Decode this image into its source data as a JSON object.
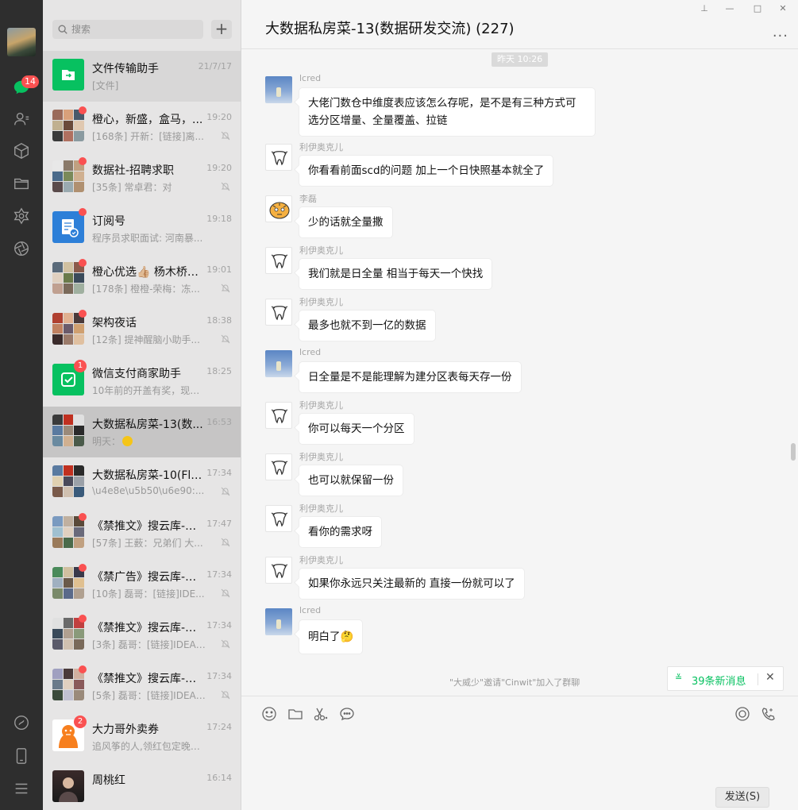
{
  "nav": {
    "unread_badge": "14"
  },
  "search": {
    "placeholder": "搜索",
    "add_label": "+"
  },
  "chats": [
    {
      "name": "文件传输助手",
      "time": "21/7/17",
      "preview": "[文件]"
    },
    {
      "name": "橙心，新盛，盒马，...",
      "time": "19:20",
      "preview": "[168条] 开新：[链接]离..."
    },
    {
      "name": "数据社-招聘求职",
      "time": "19:20",
      "preview": "[35条] 常卓君：对"
    },
    {
      "name": "订阅号",
      "time": "19:18",
      "preview": "程序员求职面试: 河南暴..."
    },
    {
      "name": "橙心优选👍🏼 杨木桥5...",
      "time": "19:01",
      "preview": "[178条] 橙橙-荣梅：冻..."
    },
    {
      "name": "架构夜话",
      "time": "18:38",
      "preview": "[12条] 提神醒脑小助手..."
    },
    {
      "name": "微信支付商家助手",
      "time": "18:25",
      "preview": "10年前的开盖有奖，现在...",
      "badge": "1"
    },
    {
      "name": "大数据私房菜-13(数...",
      "time": "16:53",
      "preview": "明天："
    },
    {
      "name": "大数据私房菜-10(Fli...",
      "time": "17:34",
      "preview": "\\u4e8e\\u5b50\\u6e90:..."
    },
    {
      "name": "《禁推文》搜云库-技...",
      "time": "17:47",
      "preview": "[57条] 王薮：兄弟们 大..."
    },
    {
      "name": "《禁广告》搜云库-技...",
      "time": "17:34",
      "preview": "[10条] 磊哥：[链接]IDE..."
    },
    {
      "name": "《禁推文》搜云库-技...",
      "time": "17:34",
      "preview": "[3条] 磊哥：[链接]IDEA ..."
    },
    {
      "name": "《禁推文》搜云库-技...",
      "time": "17:34",
      "preview": "[5条] 磊哥：[链接]IDEA ..."
    },
    {
      "name": "大力哥外卖券",
      "time": "17:24",
      "preview": "追风筝的人,领红包定晚餐...",
      "badge": "2"
    },
    {
      "name": "周桃红",
      "time": "16:14",
      "preview": ""
    }
  ],
  "chat": {
    "title": "大数据私房菜-13(数据研发交流) (227)",
    "more": "...",
    "time_divider": "昨天 10:26",
    "messages": [
      {
        "sender": "lcred",
        "text": "大佬门数仓中维度表应该怎么存呢，是不是有三种方式可选分区增量、全量覆盖、拉链"
      },
      {
        "sender": "利伊奥克儿",
        "text": "你看看前面scd的问题 加上一个日快照基本就全了"
      },
      {
        "sender": "李磊",
        "text": "少的话就全量撒"
      },
      {
        "sender": "利伊奥克儿",
        "text": "我们就是日全量  相当于每天一个快找"
      },
      {
        "sender": "利伊奥克儿",
        "text": "最多也就不到一亿的数据"
      },
      {
        "sender": "lcred",
        "text": "日全量是不是能理解为建分区表每天存一份"
      },
      {
        "sender": "利伊奥克儿",
        "text": "你可以每天一个分区"
      },
      {
        "sender": "利伊奥克儿",
        "text": "也可以就保留一份"
      },
      {
        "sender": "利伊奥克儿",
        "text": "看你的需求呀"
      },
      {
        "sender": "利伊奥克儿",
        "text": "如果你永远只关注最新的 直接一份就可以了"
      },
      {
        "sender": "lcred",
        "text": "明白了🤔"
      }
    ],
    "system_note": "\"大威少\"邀请\"Cinwit\"加入了群聊",
    "new_messages": "39条新消息",
    "send_label": "发送(S)"
  }
}
